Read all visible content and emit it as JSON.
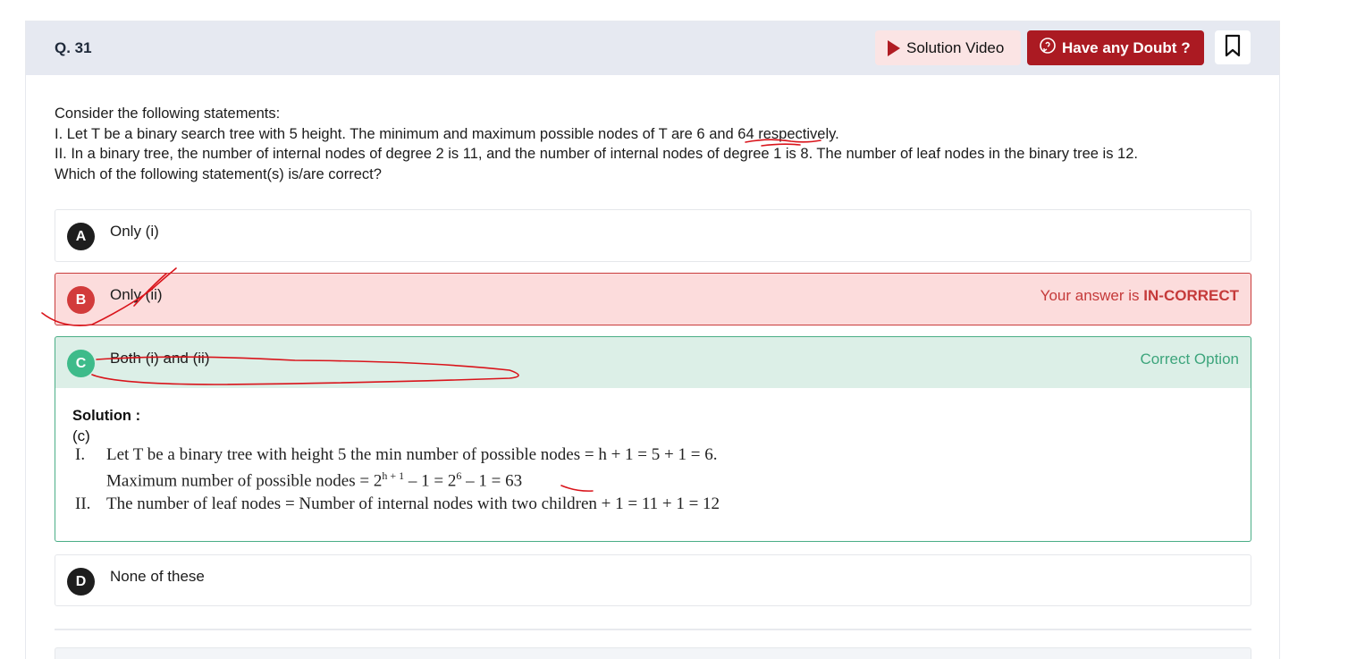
{
  "header": {
    "question_number": "Q. 31",
    "solution_video_label": "Solution Video",
    "doubt_label": "Have any Doubt ?"
  },
  "question": {
    "lines": [
      "Consider the following statements:",
      "I. Let T be a binary search tree with 5 height. The minimum and maximum possible nodes of T are 6 and 64 respectively.",
      "II. In a binary tree, the number of internal nodes of degree 2 is 11, and the number of internal nodes of degree 1 is 8. The number of leaf nodes in the binary tree is 12.",
      "Which of the following statement(s) is/are correct?"
    ]
  },
  "options": [
    {
      "letter": "A",
      "text": "Only (i)",
      "status": ""
    },
    {
      "letter": "B",
      "text": "Only (ii)",
      "status_prefix": "Your answer is ",
      "status_strong": "IN-CORRECT"
    },
    {
      "letter": "C",
      "text": "Both (i) and (ii)",
      "status": "Correct Option"
    },
    {
      "letter": "D",
      "text": "None of these",
      "status": ""
    }
  ],
  "solution": {
    "title": "Solution :",
    "answer": "(c)",
    "line1_num": "I.",
    "line1": "Let T be a binary tree with height 5 the min number of possible nodes = h + 1 = 5 + 1 = 6.",
    "line2_a": "Maximum number of possible nodes = 2",
    "line2_sup1": "h + 1",
    "line2_b": " – 1 = 2",
    "line2_sup2": "6",
    "line2_c": " – 1 = 63",
    "line3_num": "II.",
    "line3": "The number of leaf nodes = Number of internal nodes with two children + 1 = 11 + 1 = 12"
  },
  "colors": {
    "header_bg": "#e6e9f1",
    "doubt_bg": "#ab1a22",
    "incorrect_bg": "#fcdcdc",
    "incorrect_text": "#c53a3a",
    "correct_bg": "#dcefe7",
    "correct_text": "#3da57c",
    "annotation": "#d9141b"
  }
}
